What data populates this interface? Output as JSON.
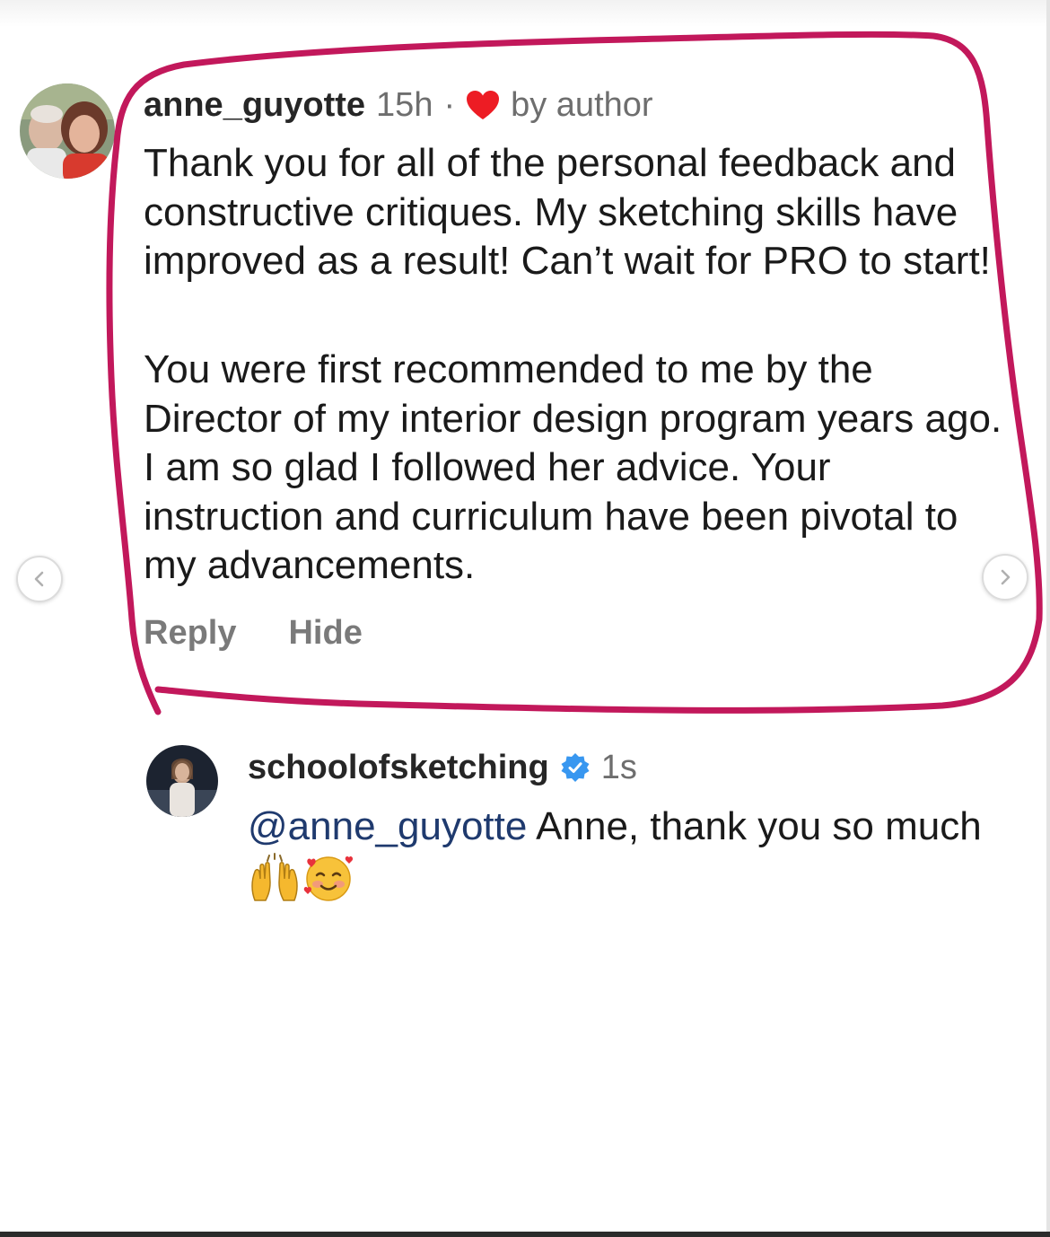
{
  "comment": {
    "username": "anne_guyotte",
    "time": "15h",
    "separator": "·",
    "liked_label": "by author",
    "paragraphs": [
      "Thank you for all of the personal feedback and constructive critiques. My sketching skills have improved as a result! Can’t wait for PRO to start!",
      "You were first recommended to me by the Director of my interior design program years ago. I am so glad I followed her advice. Your instruction and curriculum have been pivotal to my advancements."
    ],
    "actions": {
      "reply": "Reply",
      "hide": "Hide"
    }
  },
  "reply": {
    "username": "schoolofsketching",
    "time": "1s",
    "mention": "@anne_guyotte",
    "text": " Anne, thank you so much "
  },
  "icons": {
    "heart": "heart-icon",
    "verified": "verified-badge-icon",
    "prev": "chevron-left-icon",
    "next": "chevron-right-icon",
    "emoji_1": "raising-hands-emoji",
    "emoji_2": "smiling-face-with-hearts-emoji"
  },
  "colors": {
    "highlight": "#c2185b",
    "heart": "#ed1c24",
    "verified": "#3897f0",
    "mention": "#1f3a6e",
    "username": "#262626",
    "meta": "#6e6e6e"
  }
}
